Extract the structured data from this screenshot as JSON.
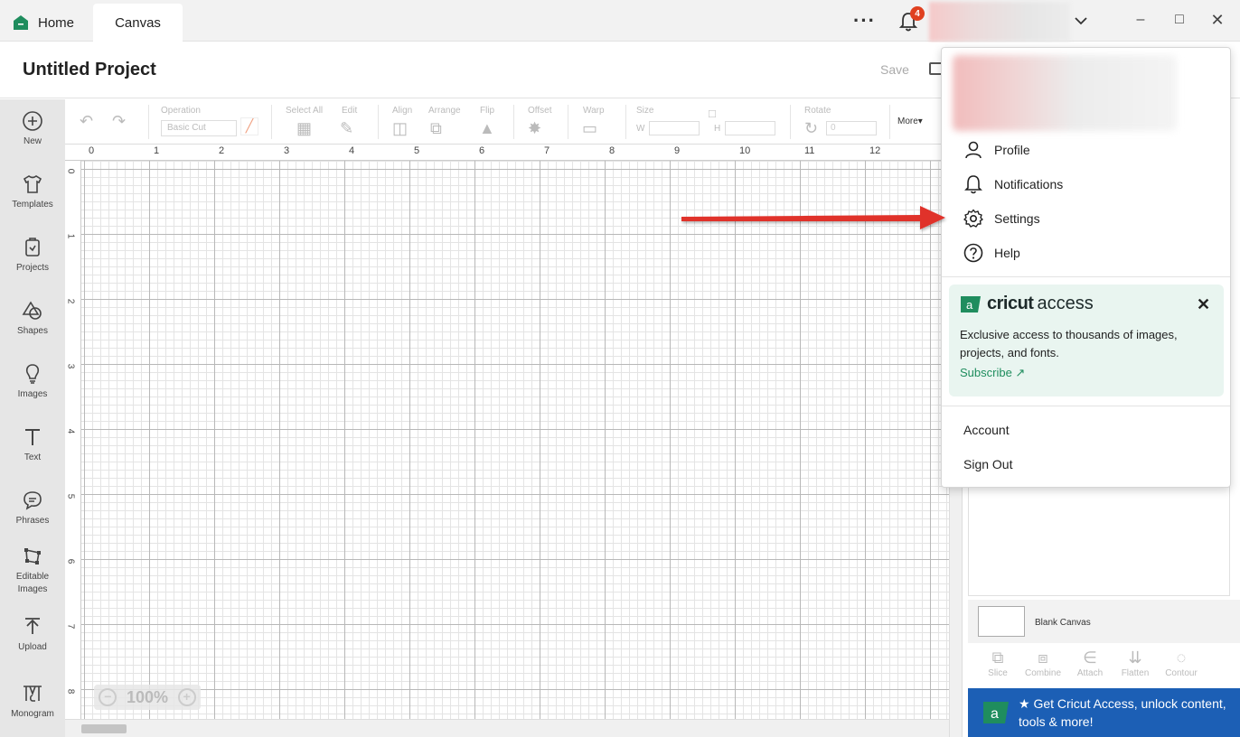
{
  "titlebar": {
    "tabs": [
      {
        "label": "Home"
      },
      {
        "label": "Canvas"
      }
    ],
    "notifications_count": "4"
  },
  "project": {
    "title": "Untitled Project",
    "save_label": "Save"
  },
  "toolbar": {
    "operation_label": "Operation",
    "operation_value": "Basic Cut",
    "select_all_label": "Select All",
    "edit_label": "Edit",
    "align_label": "Align",
    "arrange_label": "Arrange",
    "flip_label": "Flip",
    "offset_label": "Offset",
    "warp_label": "Warp",
    "size_label": "Size",
    "w_label": "W",
    "h_label": "H",
    "rotate_label": "Rotate",
    "rotate_value": "0",
    "more_label": "More"
  },
  "sidebar": {
    "items": [
      {
        "label": "New",
        "icon": "plus-circle-icon"
      },
      {
        "label": "Templates",
        "icon": "shirt-icon"
      },
      {
        "label": "Projects",
        "icon": "projects-icon"
      },
      {
        "label": "Shapes",
        "icon": "shapes-icon"
      },
      {
        "label": "Images",
        "icon": "lightbulb-icon"
      },
      {
        "label": "Text",
        "icon": "text-icon"
      },
      {
        "label": "Phrases",
        "icon": "speech-bubble-icon"
      },
      {
        "label": "Editable Images",
        "icon": "vector-edit-icon"
      },
      {
        "label": "Upload",
        "icon": "upload-icon"
      },
      {
        "label": "Monogram",
        "icon": "monogram-icon"
      }
    ]
  },
  "rulers": {
    "top": [
      "0",
      "1",
      "2",
      "3",
      "4",
      "5",
      "6",
      "7",
      "8",
      "9",
      "10",
      "11",
      "12"
    ],
    "left": [
      "0",
      "1",
      "2",
      "3",
      "4",
      "5",
      "6",
      "7",
      "8"
    ]
  },
  "canvas": {
    "zoom": "100%"
  },
  "right_panel": {
    "blank_canvas_label": "Blank Canvas",
    "actions": [
      {
        "label": "Slice"
      },
      {
        "label": "Combine"
      },
      {
        "label": "Attach"
      },
      {
        "label": "Flatten"
      },
      {
        "label": "Contour"
      }
    ],
    "promo_text": "Get Cricut Access, unlock content, tools & more!"
  },
  "dropdown": {
    "items": [
      {
        "label": "Profile"
      },
      {
        "label": "Notifications"
      },
      {
        "label": "Settings"
      },
      {
        "label": "Help"
      }
    ],
    "access": {
      "brand_bold": "cricut",
      "brand_light": "access",
      "description": "Exclusive access to thousands of images, projects, and fonts.",
      "subscribe": "Subscribe ↗"
    },
    "account_label": "Account",
    "signout_label": "Sign Out"
  },
  "colors": {
    "brand_green": "#1f8d5e",
    "promo_blue": "#1c5fb5",
    "arrow_red": "#e0302a",
    "badge_red": "#e0401f"
  }
}
